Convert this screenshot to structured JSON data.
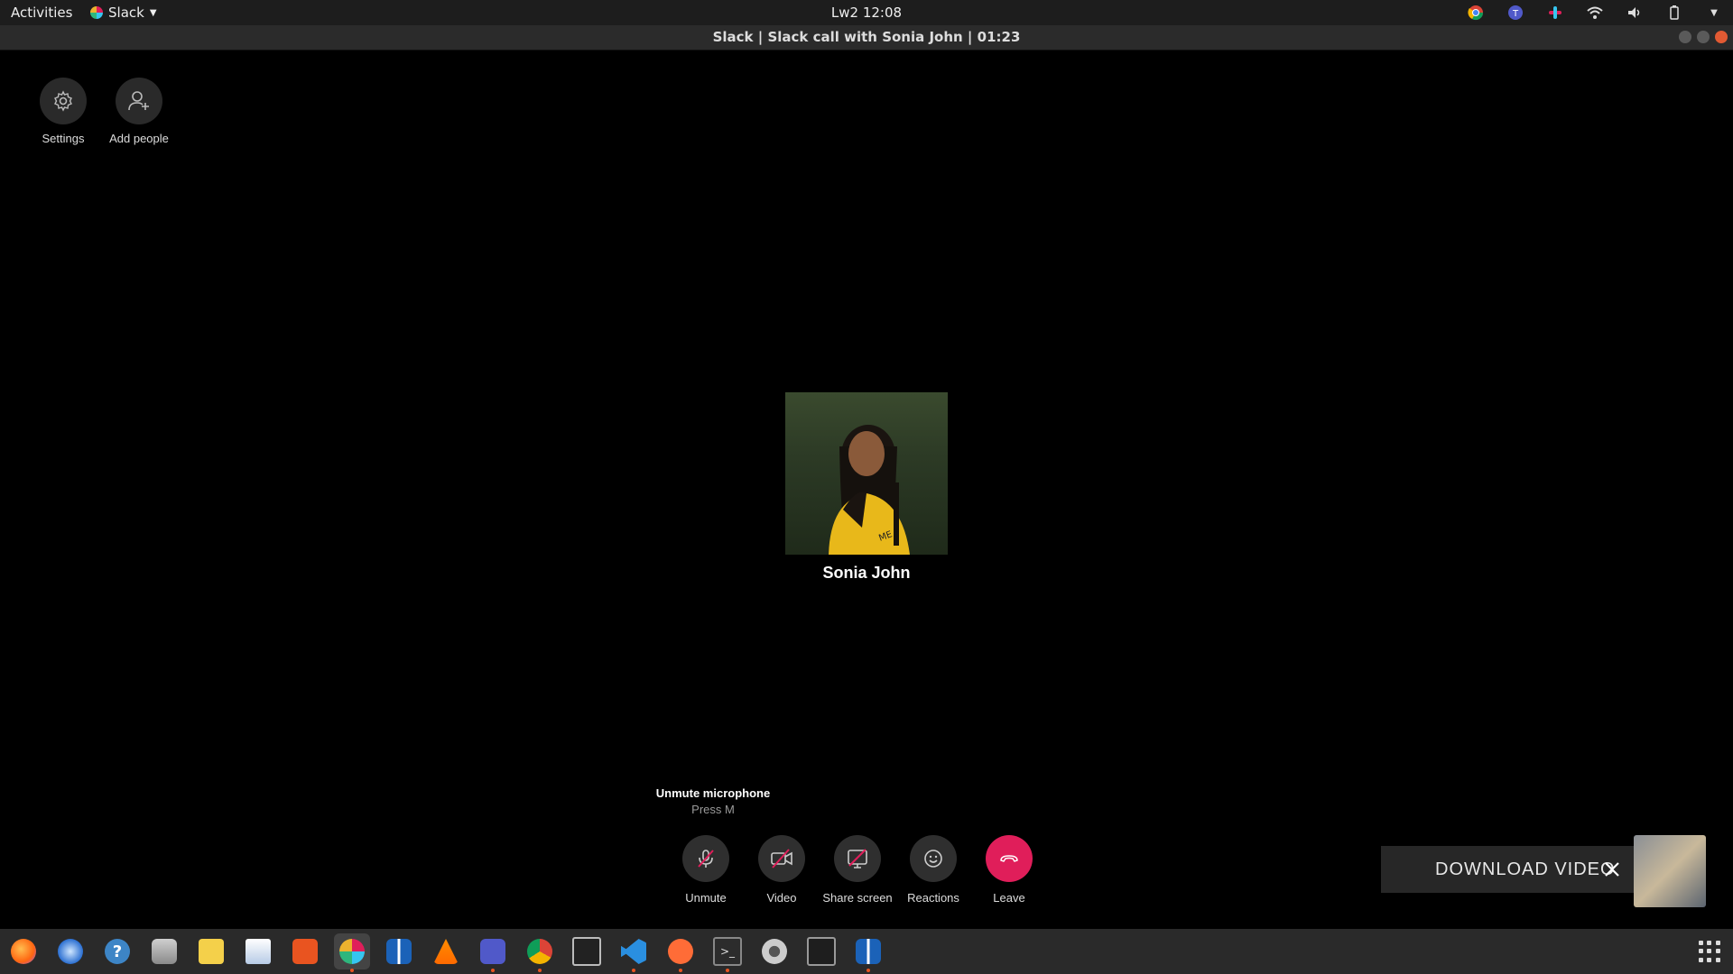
{
  "topbar": {
    "activities": "Activities",
    "app_menu": "Slack",
    "clock": "Lw2 12:08"
  },
  "window": {
    "title": "Slack | Slack call with Sonia John | 01:23"
  },
  "top_controls": {
    "settings": "Settings",
    "add_people": "Add people"
  },
  "call": {
    "participant_name": "Sonia John"
  },
  "tooltip": {
    "title": "Unmute microphone",
    "hint": "Press M"
  },
  "controls": {
    "unmute": "Unmute",
    "video": "Video",
    "share_screen": "Share screen",
    "reactions": "Reactions",
    "leave": "Leave"
  },
  "download_banner": {
    "label": "DOWNLOAD VIDEO"
  },
  "colors": {
    "leave_red": "#e01e5a",
    "background": "#000000",
    "panel": "#2f2f2f"
  },
  "dock_icons": [
    "firefox-icon",
    "thunderbird-icon",
    "help-icon",
    "files-icon",
    "rhythmbox-icon",
    "writer-icon",
    "software-icon",
    "slack-icon",
    "remmina-icon",
    "vlc-icon",
    "teams-icon",
    "chrome-icon",
    "system-monitor-icon",
    "vscode-icon",
    "postman-icon",
    "terminal-icon",
    "settings-icon",
    "monitor-icon",
    "remmina2-icon"
  ]
}
